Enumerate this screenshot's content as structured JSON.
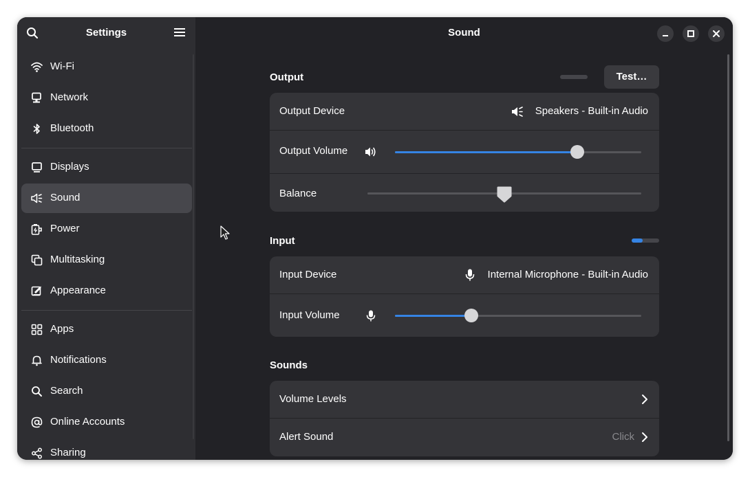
{
  "sidebar": {
    "title": "Settings",
    "search_icon": "search-icon",
    "menu_icon": "hamburger-menu-icon",
    "groups": [
      [
        {
          "label": "Wi-Fi",
          "icon": "wifi-icon"
        },
        {
          "label": "Network",
          "icon": "network-icon"
        },
        {
          "label": "Bluetooth",
          "icon": "bluetooth-icon"
        }
      ],
      [
        {
          "label": "Displays",
          "icon": "display-icon"
        },
        {
          "label": "Sound",
          "icon": "sound-icon",
          "active": true
        },
        {
          "label": "Power",
          "icon": "power-icon"
        },
        {
          "label": "Multitasking",
          "icon": "multitasking-icon"
        },
        {
          "label": "Appearance",
          "icon": "appearance-icon"
        }
      ],
      [
        {
          "label": "Apps",
          "icon": "apps-icon"
        },
        {
          "label": "Notifications",
          "icon": "bell-icon"
        },
        {
          "label": "Search",
          "icon": "search-icon"
        },
        {
          "label": "Online Accounts",
          "icon": "at-icon"
        },
        {
          "label": "Sharing",
          "icon": "share-icon"
        }
      ]
    ]
  },
  "main": {
    "title": "Sound",
    "output": {
      "title": "Output",
      "test_label": "Test…",
      "device_label": "Output Device",
      "device_value": "Speakers - Built-in Audio",
      "volume_label": "Output Volume",
      "volume_level": 0.74,
      "balance_label": "Balance",
      "balance_level": 0.5
    },
    "input": {
      "title": "Input",
      "level_meter": 0.4,
      "device_label": "Input Device",
      "device_value": "Internal Microphone - Built-in Audio",
      "volume_label": "Input Volume",
      "volume_level": 0.31
    },
    "sounds": {
      "title": "Sounds",
      "volume_levels_label": "Volume Levels",
      "alert_sound_label": "Alert Sound",
      "alert_sound_value": "Click"
    }
  },
  "colors": {
    "accent": "#3584e4",
    "sidebar_bg": "#2e2e32",
    "main_bg": "#222226",
    "card_bg": "#343438"
  }
}
